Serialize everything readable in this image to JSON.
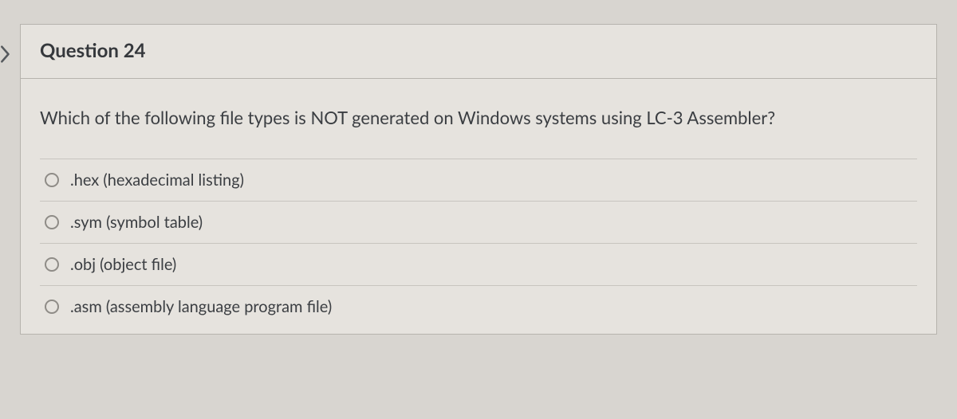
{
  "header": {
    "title": "Question 24"
  },
  "question": {
    "prompt": "Which of the following file types is NOT generated on Windows systems using LC-3 Assembler?"
  },
  "options": [
    {
      "label": ".hex (hexadecimal listing)"
    },
    {
      "label": ".sym (symbol table)"
    },
    {
      "label": ".obj (object file)"
    },
    {
      "label": ".asm (assembly language program file)"
    }
  ]
}
